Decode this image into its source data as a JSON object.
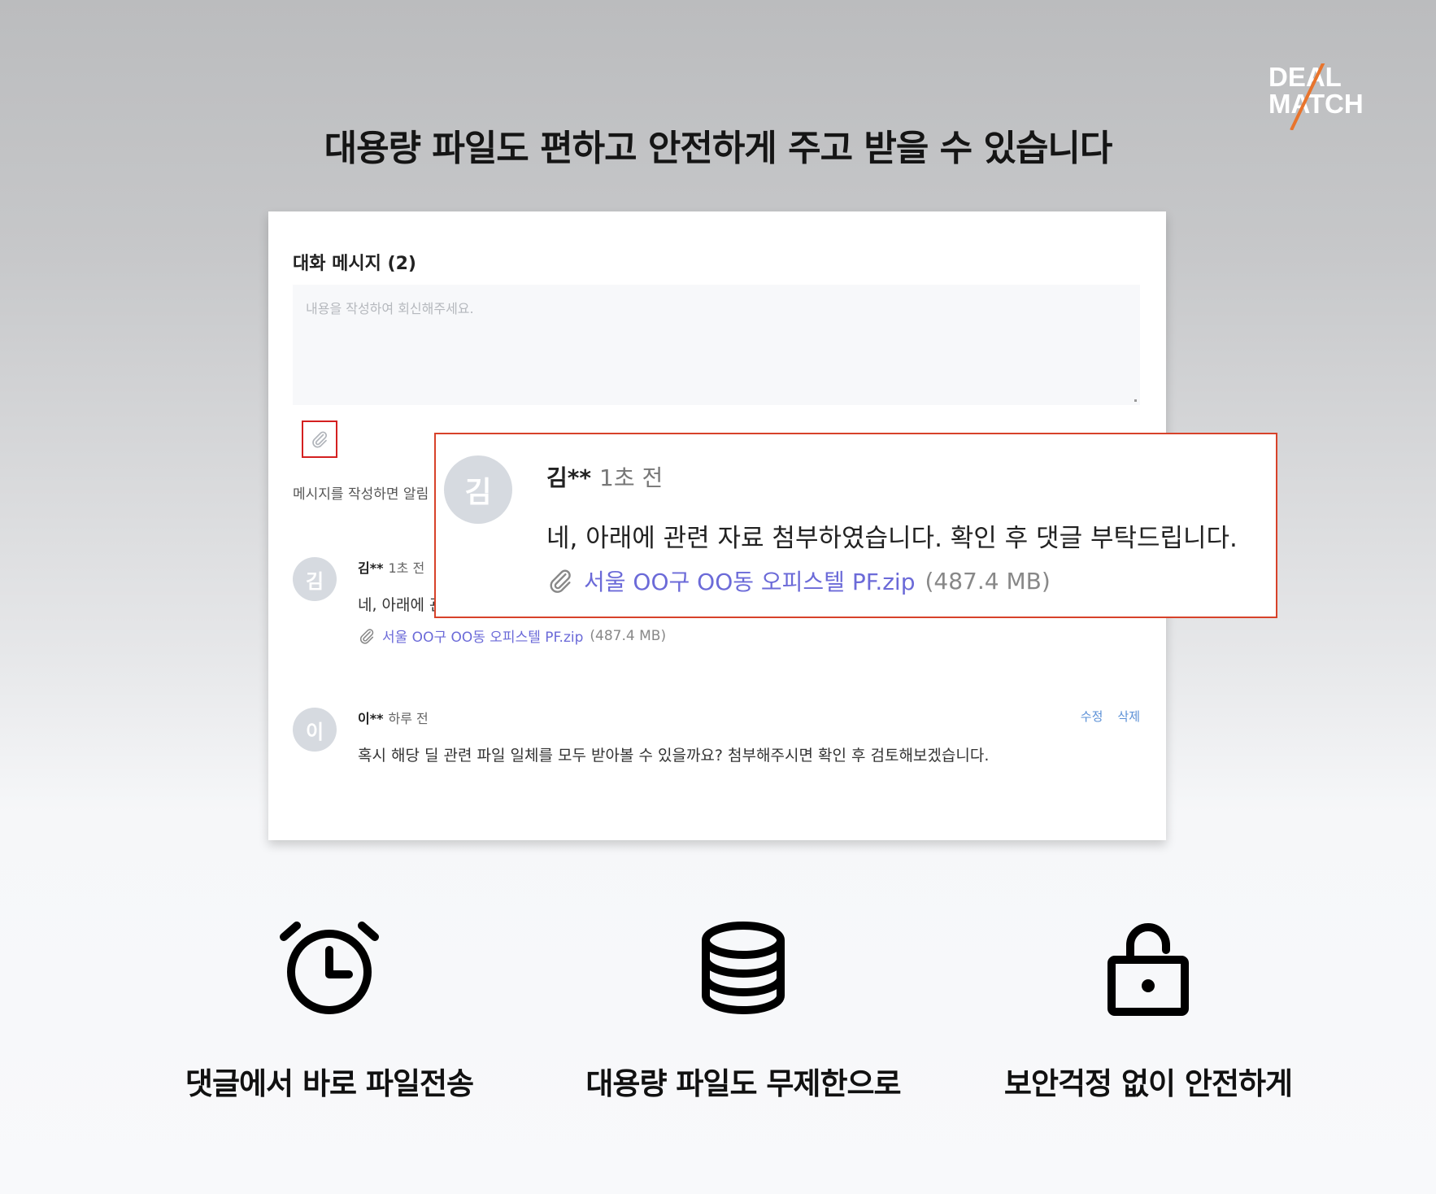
{
  "logo": {
    "line1": "DEAL",
    "line2": "MATCH",
    "accent_color": "#e8742c"
  },
  "headline": "대용량 파일도 편하고 안전하게 주고 받을 수 있습니다",
  "panel": {
    "title": "대화 메시지 (2)",
    "textarea_placeholder": "내용을 작성하여 회신해주세요.",
    "notice": "메시지를 작성하면 알림",
    "comments": [
      {
        "avatar": "김",
        "author": "김**",
        "time": "1초 전",
        "body": "네, 아래에 관",
        "file_name": "서울 OO구 OO동 오피스텔 PF.zip",
        "file_size": "(487.4 MB)"
      },
      {
        "avatar": "이",
        "author": "이**",
        "time": "하루 전",
        "body": "혹시 해당 딜 관련 파일 일체를 모두 받아볼 수 있을까요? 첨부해주시면 확인 후 검토해보겠습니다.",
        "edit_label": "수정",
        "delete_label": "삭제"
      }
    ]
  },
  "popup": {
    "avatar": "김",
    "author": "김**",
    "time": "1초 전",
    "body": "네, 아래에 관련 자료 첨부하였습니다. 확인 후 댓글 부탁드립니다.",
    "file_name": "서울 OO구 OO동 오피스텔 PF.zip",
    "file_size": "(487.4 MB)"
  },
  "features": [
    {
      "icon": "alarm-clock-icon",
      "label": "댓글에서 바로 파일전송"
    },
    {
      "icon": "database-icon",
      "label": "대용량 파일도 무제한으로"
    },
    {
      "icon": "unlock-icon",
      "label": "보안걱정 없이 안전하게"
    }
  ]
}
